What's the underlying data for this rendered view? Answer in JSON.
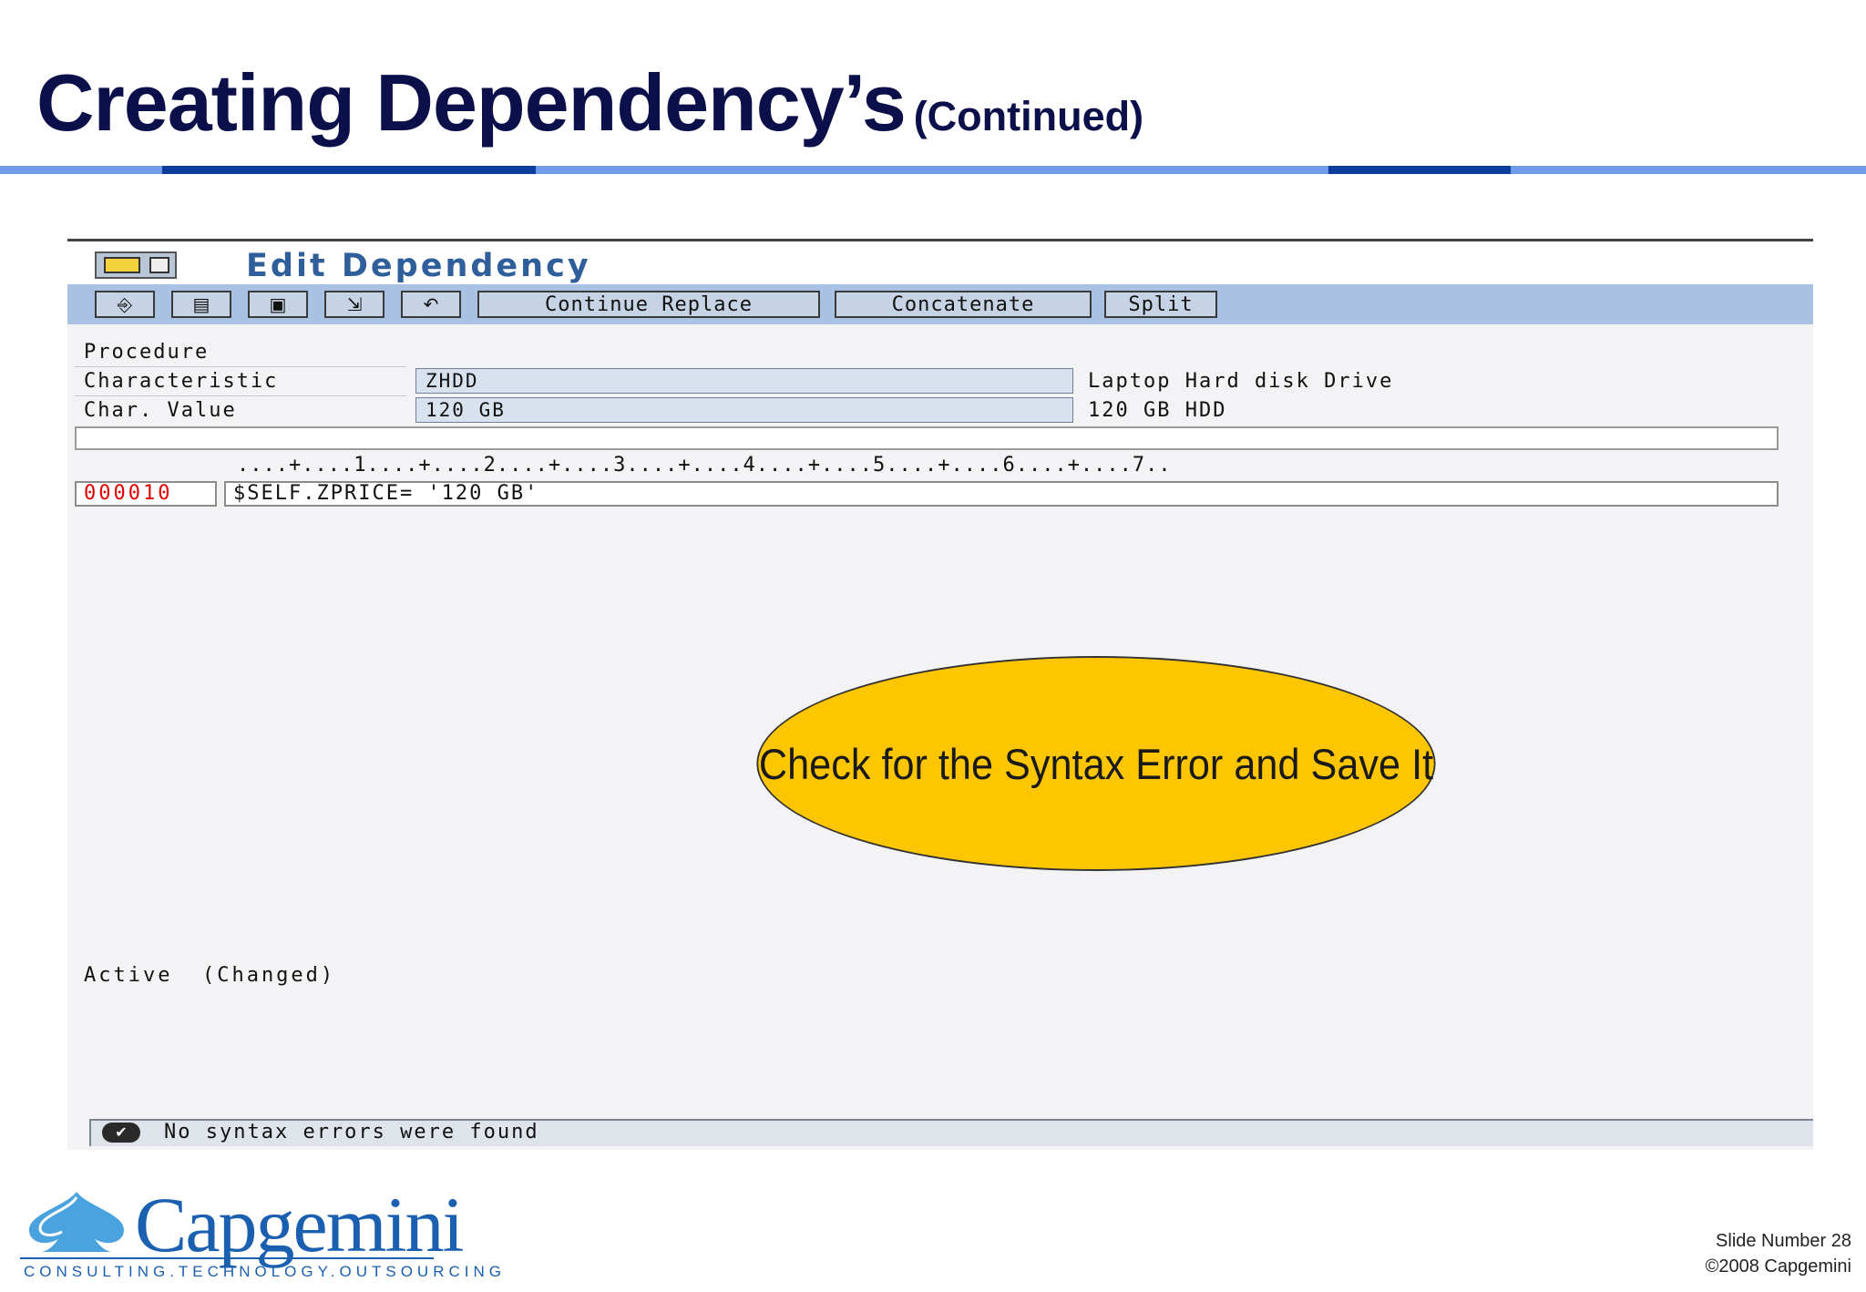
{
  "slide": {
    "title": "Creating Dependency’s",
    "subtitle": "(Continued)"
  },
  "sap": {
    "screen_title": "Edit Dependency",
    "toolbar": {
      "icons": [
        "insert-line-icon",
        "copy-block-icon",
        "paste-icon",
        "select-icon",
        "undo-icon"
      ],
      "buttons": [
        "Continue Replace",
        "Concatenate",
        "Split"
      ]
    },
    "fields": {
      "procedure_label": "Procedure",
      "characteristic_label": "Characteristic",
      "characteristic_value": "ZHDD",
      "characteristic_desc": "Laptop Hard disk Drive",
      "char_value_label": "Char. Value",
      "char_value_value": "120 GB",
      "char_value_desc": "120 GB HDD"
    },
    "editor": {
      "ruler": "....+....1....+....2....+....3....+....4....+....5....+....6....+....7..",
      "line_number": "000010",
      "code": "$SELF.ZPRICE= '120 GB'"
    },
    "status_text": "Active  (Changed)",
    "status_message": "No syntax errors were found"
  },
  "callout": {
    "text": "Check for the Syntax Error and Save It"
  },
  "logo": {
    "name": "Capgemini",
    "tagline": "CONSULTING.TECHNOLOGY.OUTSOURCING"
  },
  "footer": {
    "slide_number": "Slide Number 28",
    "copyright": "©2008 Capgemini"
  },
  "colors": {
    "title": "#0b0f4a",
    "rule_light": "#6f9be8",
    "rule_dark": "#0d3d9a",
    "toolbar": "#a9c2e3",
    "callout": "#fec600",
    "brand": "#1a5fb0"
  }
}
